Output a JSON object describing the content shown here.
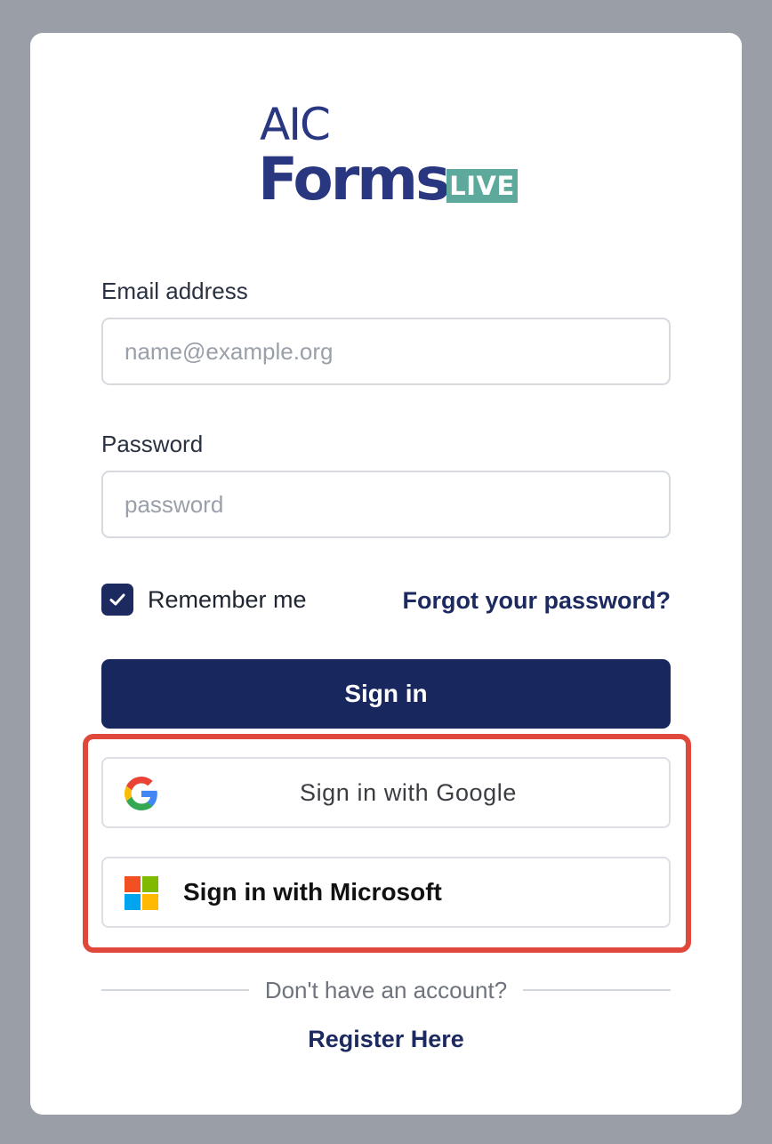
{
  "logo": {
    "line1": "AIC",
    "line2": "Forms",
    "badge": "LIVE"
  },
  "email": {
    "label": "Email address",
    "placeholder": "name@example.org",
    "value": ""
  },
  "password": {
    "label": "Password",
    "placeholder": "password",
    "value": ""
  },
  "remember": {
    "label": "Remember me",
    "checked": true
  },
  "forgot_link": "Forgot your password?",
  "signin_button": "Sign in",
  "google_button": {
    "label": "Sign in with Google",
    "icon": "google-g-icon"
  },
  "microsoft_button": {
    "label": "Sign in with Microsoft",
    "icon": "microsoft-logo-icon"
  },
  "divider_text": "Don't have an account?",
  "register_link": "Register Here",
  "colors": {
    "primary": "#19275f",
    "brand_blue": "#28377f",
    "badge_green": "#5daa9c",
    "highlight_red": "#e0483b",
    "background": "#9a9ea7"
  }
}
